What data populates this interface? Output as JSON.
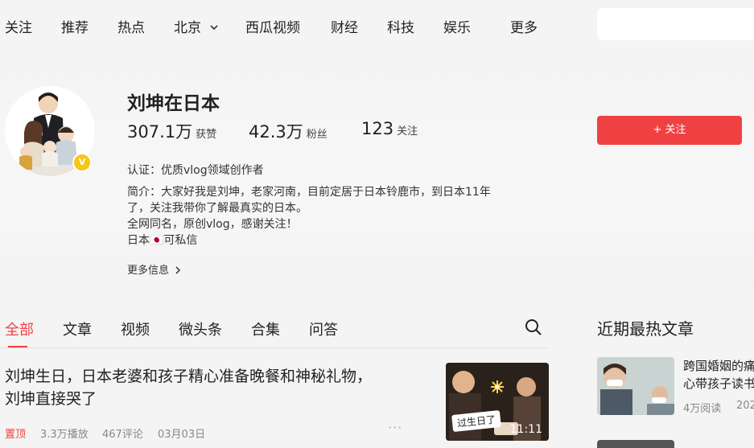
{
  "nav": {
    "items": [
      "关注",
      "推荐",
      "热点",
      "北京",
      "西瓜视频",
      "财经",
      "科技",
      "娱乐",
      "更多"
    ]
  },
  "profile": {
    "name": "刘坤在日本",
    "likes_num": "307.1万",
    "likes_label": "获赞",
    "fans_num": "42.3万",
    "fans_label": "粉丝",
    "following_num": "123",
    "following_label": "关注",
    "certification": "认证：优质vlog领域创作者",
    "bio_lines": [
      "简介：大家好我是刘坤，老家河南，目前定居于日本铃鹿市，到日本11年",
      "了，关注我带你了解最真实的日本。",
      "全网同名，原创vlog，感谢关注！",
      "日本🇯🇵可私信"
    ],
    "more_info": "更多信息",
    "follow_button": "+ 关注",
    "verified_badge": "V"
  },
  "tabs": [
    "全部",
    "文章",
    "视频",
    "微头条",
    "合集",
    "问答"
  ],
  "feed": {
    "items": [
      {
        "title_line1": "刘坤生日，日本老婆和孩子精心准备晚餐和神秘礼物，",
        "title_line2": "刘坤直接哭了",
        "pin": "置顶",
        "plays": "3.3万播放",
        "comments": "467评论",
        "date": "03月03日",
        "thumb_badge": "过生日了",
        "duration": "11:11"
      }
    ]
  },
  "sidebar": {
    "title": "近期最热文章",
    "items": [
      {
        "title_line1": "跨国婚姻的痛",
        "title_line2": "心带孩子读书",
        "reads": "4万阅读",
        "date": "202"
      }
    ]
  },
  "colors": {
    "accent": "#f04142",
    "badge": "#f5c518"
  },
  "icons": {
    "search": "search-icon",
    "chevron": "chevron-down-icon",
    "more": "more-dots-icon"
  }
}
